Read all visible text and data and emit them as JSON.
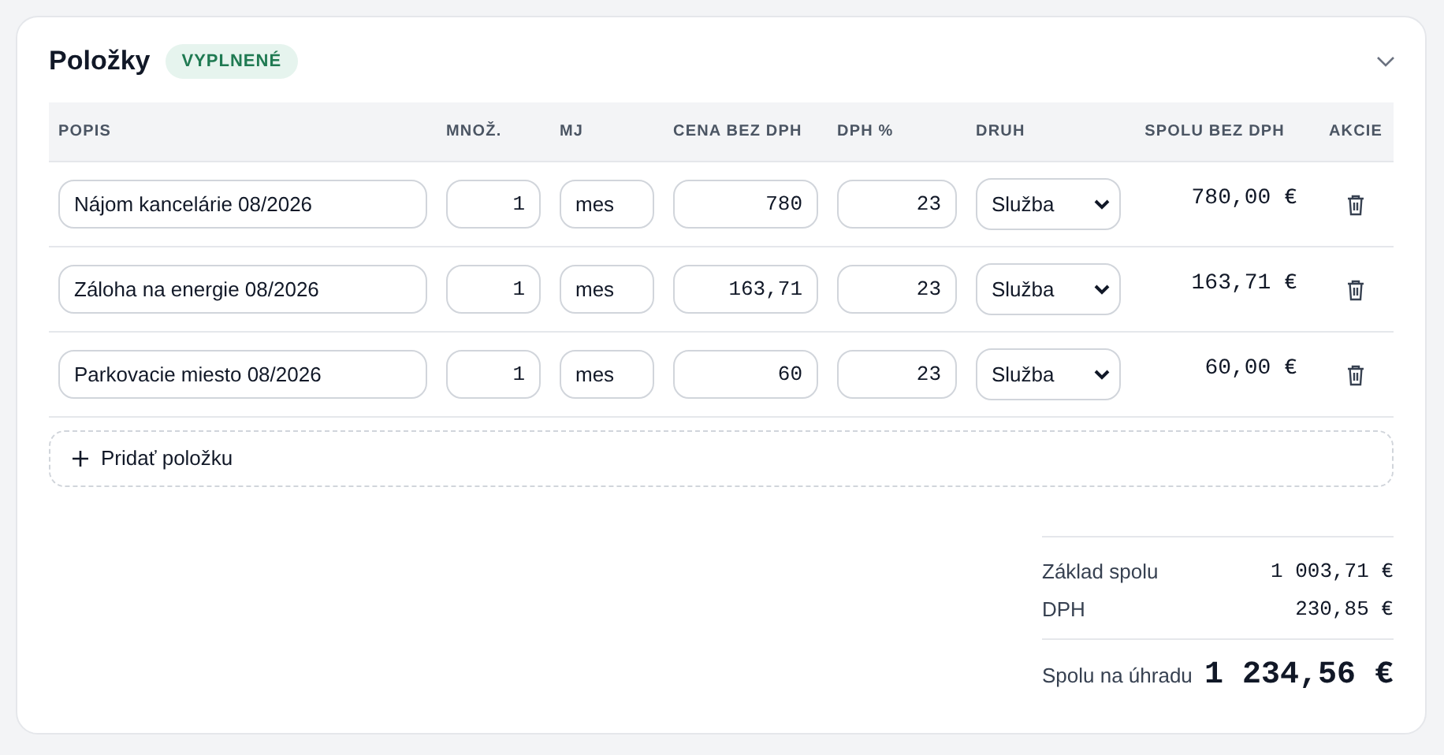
{
  "section": {
    "title": "Položky",
    "badge": "VYPLNENÉ",
    "expanded": true
  },
  "table": {
    "columns": [
      "POPIS",
      "MNOŽ.",
      "MJ",
      "CENA BEZ DPH",
      "DPH %",
      "DRUH",
      "SPOLU BEZ DPH",
      "AKCIE"
    ],
    "rows": [
      {
        "description": "Nájom kancelárie 08/2026",
        "quantity": "1",
        "unit": "mes",
        "price": "780",
        "vat": "23",
        "kind": "Služba",
        "total": "780,00 €"
      },
      {
        "description": "Záloha na energie 08/2026",
        "quantity": "1",
        "unit": "mes",
        "price": "163,71",
        "vat": "23",
        "kind": "Služba",
        "total": "163,71 €"
      },
      {
        "description": "Parkovacie miesto 08/2026",
        "quantity": "1",
        "unit": "mes",
        "price": "60",
        "vat": "23",
        "kind": "Služba",
        "total": "60,00 €"
      }
    ]
  },
  "add_button": "Pridať položku",
  "totals": [
    {
      "label": "Základ spolu",
      "value": "1 003,71 €",
      "kind": "sub"
    },
    {
      "label": "DPH",
      "value": "230,85 €",
      "kind": "sub"
    },
    {
      "label": "Spolu na úhradu",
      "value": "1 234,56 €",
      "kind": "grand"
    }
  ]
}
